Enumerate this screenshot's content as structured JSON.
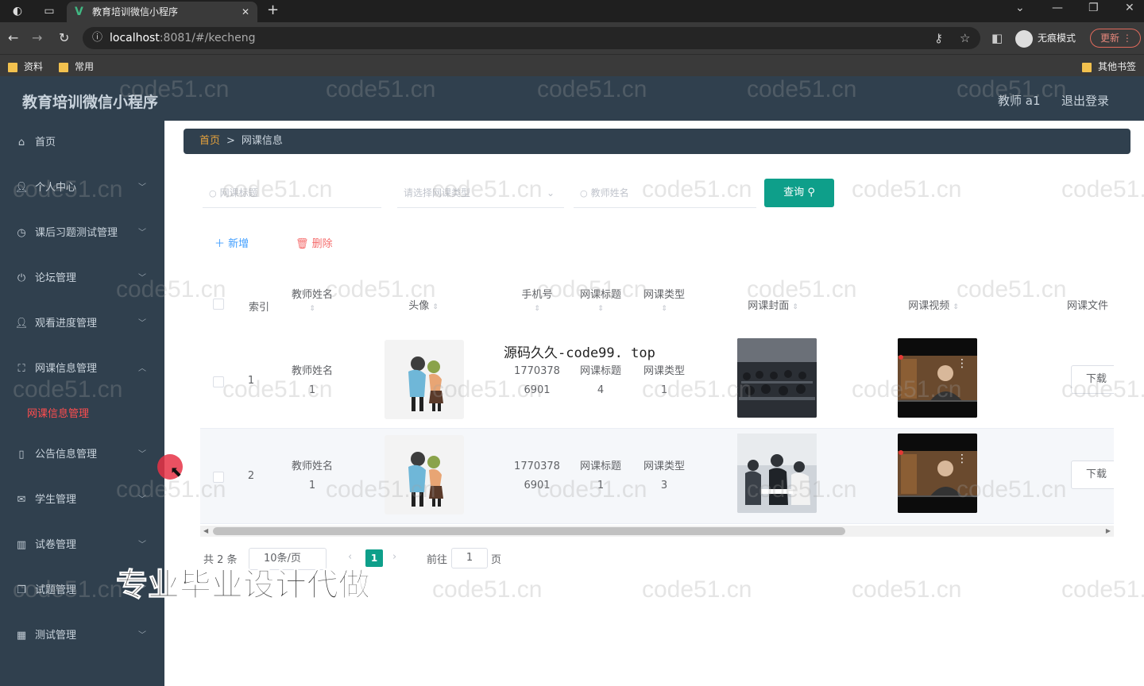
{
  "browser": {
    "tab_title": "教育培训微信小程序",
    "url_host": "localhost",
    "url_path": ":8081/#/kecheng",
    "incognito_label": "无痕模式",
    "update_label": "更新",
    "bookmarks": [
      "资料",
      "常用"
    ],
    "other_bookmarks": "其他书签"
  },
  "header": {
    "title": "教育培训微信小程序",
    "user": "教师 a1",
    "logout": "退出登录"
  },
  "sidebar": {
    "items": [
      {
        "label": "首页",
        "icon": "home-icon"
      },
      {
        "label": "个人中心",
        "icon": "user-icon"
      },
      {
        "label": "课后习题测试管理",
        "icon": "clock-icon"
      },
      {
        "label": "论坛管理",
        "icon": "power-icon"
      },
      {
        "label": "观看进度管理",
        "icon": "user-icon"
      },
      {
        "label": "网课信息管理",
        "icon": "fullscreen-icon"
      },
      {
        "label": "公告信息管理",
        "icon": "phone-icon"
      },
      {
        "label": "学生管理",
        "icon": "mail-icon"
      },
      {
        "label": "试卷管理",
        "icon": "bar-chart-icon"
      },
      {
        "label": "试题管理",
        "icon": "copy-icon"
      },
      {
        "label": "测试管理",
        "icon": "calendar-icon"
      }
    ],
    "submenu_active": "网课信息管理"
  },
  "breadcrumb": {
    "home": "首页",
    "separator": ">",
    "current": "网课信息"
  },
  "search": {
    "title_placeholder": "网课标题",
    "type_placeholder": "请选择网课类型",
    "teacher_placeholder": "教师姓名",
    "query_label": "查询"
  },
  "actions": {
    "add": "新增",
    "delete": "删除"
  },
  "table": {
    "headers": {
      "index": "索引",
      "teacher": "教师姓名",
      "avatar": "头像",
      "phone": "手机号",
      "title": "网课标题",
      "type": "网课类型",
      "cover": "网课封面",
      "video": "网课视频",
      "file": "网课文件"
    },
    "rows": [
      {
        "index": "1",
        "teacher_1": "教师姓名",
        "teacher_2": "1",
        "phone_1": "1770378",
        "phone_2": "6901",
        "title_1": "网课标题",
        "title_2": "4",
        "type_1": "网课类型",
        "type_2": "1",
        "download": "下载"
      },
      {
        "index": "2",
        "teacher_1": "教师姓名",
        "teacher_2": "1",
        "phone_1": "1770378",
        "phone_2": "6901",
        "title_1": "网课标题",
        "title_2": "1",
        "type_1": "网课类型",
        "type_2": "3",
        "download": "下载"
      }
    ]
  },
  "pagination": {
    "total": "共 2 条",
    "page_size": "10条/页",
    "current": "1",
    "goto_label": "前往",
    "goto_value": "1",
    "page_unit": "页"
  },
  "overlays": {
    "mid_watermark": "源码久久-code99. top",
    "big_watermark": "专业毕业设计代做",
    "tiled_watermark": "code51.cn"
  }
}
